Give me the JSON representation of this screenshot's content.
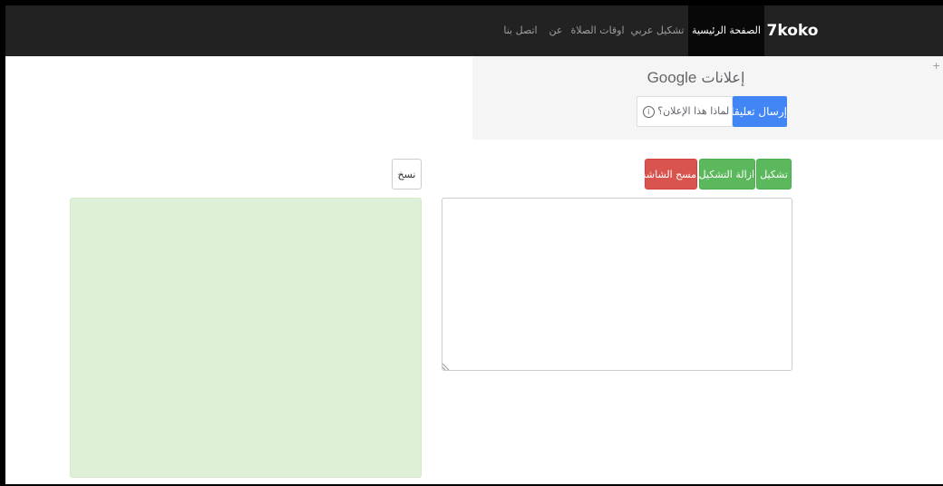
{
  "navbar": {
    "brand": "7koko",
    "items": [
      {
        "label": "الصفحة الرئيسية",
        "active": true
      },
      {
        "label": "تشكيل عربي",
        "active": false
      },
      {
        "label": "اوقات الصلاة",
        "active": false
      },
      {
        "label": "عن",
        "active": false
      },
      {
        "label": "اتصل بنا",
        "active": false
      }
    ]
  },
  "ad": {
    "title_ar": "إعلانات",
    "title_brand": "Google",
    "send_feedback": "إرسال تعليقات",
    "why_this_ad": "لماذا هذا الإعلان؟",
    "info_icon": "info-icon",
    "corner_mark": "+"
  },
  "toolbar": {
    "tashkeel_label": "تشكيل",
    "remove_tashkeel_label": "ازالة التشكيل",
    "clear_label": "مسح الشاشه",
    "copy_label": "نسخ"
  },
  "editor": {
    "input_value": "",
    "output_text": ""
  },
  "colors": {
    "navbar_bg": "#222222",
    "navbar_active_bg": "#080808",
    "success": "#5cb85c",
    "danger": "#d9534f",
    "google_blue": "#4285f4",
    "output_bg": "#dff0d8"
  }
}
